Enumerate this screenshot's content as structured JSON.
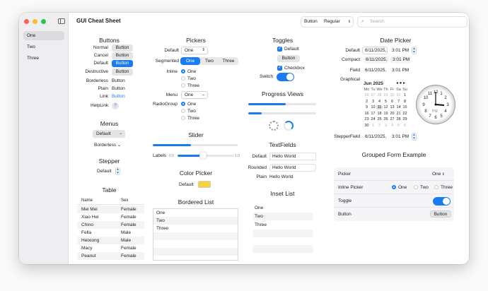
{
  "window": {
    "title": "GUI Cheat Sheet"
  },
  "toolbar": {
    "button": "Button",
    "picker": "Regular",
    "search_placeholder": "Search"
  },
  "sidebar": {
    "items": [
      "One",
      "Two",
      "Three"
    ]
  },
  "buttons": {
    "title": "Buttons",
    "rows": [
      {
        "label": "Normal",
        "button": "Button"
      },
      {
        "label": "Cancel",
        "button": "Button"
      },
      {
        "label": "Default",
        "button": "Button"
      },
      {
        "label": "Destructive",
        "button": "Button"
      },
      {
        "label": "Borderless",
        "button": "Button"
      },
      {
        "label": "Plain",
        "button": "Button"
      },
      {
        "label": "Link",
        "button": "Button"
      }
    ],
    "helplink_label": "HelpLink",
    "help_glyph": "?"
  },
  "menus": {
    "title": "Menus",
    "default": "Default",
    "borderless": "Borderless"
  },
  "stepper": {
    "title": "Stepper",
    "label": "Default"
  },
  "table": {
    "title": "Table",
    "columns": [
      "Name",
      "Sex"
    ],
    "rows": [
      [
        "Mei Mei",
        "Female"
      ],
      [
        "Xiao Hei",
        "Female"
      ],
      [
        "Chino",
        "Female"
      ],
      [
        "Fella",
        "Male"
      ],
      [
        "Heixiong",
        "Male"
      ],
      [
        "Macy",
        "Female"
      ],
      [
        "Peanut",
        "Female"
      ]
    ]
  },
  "pickers": {
    "title": "Pickers",
    "default_label": "Default",
    "default_value": "One",
    "segmented_label": "Segmented",
    "segments": [
      "One",
      "Two",
      "Three"
    ],
    "inline_label": "Inline",
    "inline_options": [
      "One",
      "Two",
      "Three"
    ],
    "menu_label": "Menu",
    "menu_value": "One",
    "radio_label": "RadioGroup",
    "radio_options": [
      "One",
      "Two",
      "Three"
    ]
  },
  "slider": {
    "title": "Slider",
    "label": "Labels",
    "min": "0.0",
    "max": "1.0",
    "value": 0.45
  },
  "color_picker": {
    "title": "Color Picker",
    "label": "Default",
    "color": "#f5d33a"
  },
  "bordered_list": {
    "title": "Bordered List",
    "items": [
      "One",
      "Two",
      "Three"
    ]
  },
  "toggles": {
    "title": "Toggles",
    "default": "Default",
    "button": "Button",
    "checkbox": "Checkbox",
    "switch_label": "Switch"
  },
  "progress": {
    "title": "Progress Views",
    "bar1": 0.55,
    "bar2": 0.2
  },
  "textfields": {
    "title": "TextFields",
    "rows": [
      {
        "label": "Default",
        "value": "Hello World"
      },
      {
        "label": "Rounded",
        "value": "Hello World"
      },
      {
        "label": "Plain",
        "value": "Hello World"
      }
    ]
  },
  "inset_list": {
    "title": "Inset List",
    "items": [
      "One",
      "Two",
      "Three"
    ]
  },
  "datepicker": {
    "title": "Date Picker",
    "default_label": "Default",
    "compact_label": "Compact",
    "field_label": "Field",
    "graphical_label": "Graphical",
    "stepperfield_label": "StepperField",
    "date": "6/11/2025,",
    "time": "3:01 PM",
    "month": "Jun 2025",
    "weekdays": [
      "Mo",
      "Tu",
      "We",
      "Th",
      "Fr",
      "Sa",
      "Su"
    ],
    "days": [
      "26",
      "27",
      "28",
      "29",
      "30",
      "31",
      "1",
      "2",
      "3",
      "4",
      "5",
      "6",
      "7",
      "8",
      "9",
      "10",
      "11",
      "12",
      "13",
      "14",
      "15",
      "16",
      "17",
      "18",
      "19",
      "20",
      "21",
      "22",
      "23",
      "24",
      "25",
      "26",
      "27",
      "28",
      "29",
      "30",
      "1",
      "2",
      "3",
      "4",
      "5",
      "6"
    ],
    "clock_pm": "PM"
  },
  "form": {
    "title": "Grouped Form Example",
    "picker_label": "Picker",
    "picker_value": "One",
    "inline_label": "Inline Picker",
    "inline_options": [
      "One",
      "Two",
      "Three"
    ],
    "toggle_label": "Toggle",
    "button_label": "Button",
    "button": "Button"
  }
}
